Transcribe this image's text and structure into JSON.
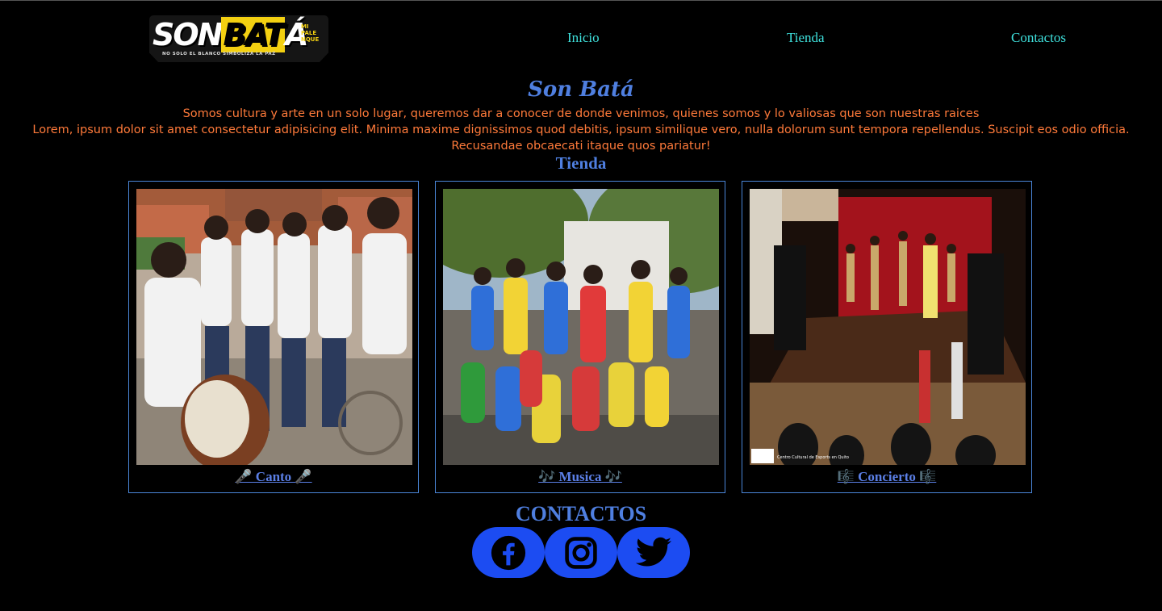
{
  "brand": {
    "logo_word": [
      "SON",
      "BAT",
      "Á"
    ],
    "logo_side_text": "MI PALE NQUE",
    "logo_tagline": "NO SOLO EL BLANCO SIMBOLIZA LA PAZ"
  },
  "nav": {
    "items": [
      "Inicio",
      "Tienda",
      "Contactos"
    ],
    "color": "#3ee0dc"
  },
  "hero": {
    "title": "Son Batá",
    "line1": "Somos cultura y arte en un solo lugar, queremos dar a conocer de donde venimos, quienes somos y lo valiosas que son nuestras raices",
    "line2": "Lorem, ipsum dolor sit amet consectetur adipisicing elit. Minima maxime dignissimos quod debitis, ipsum similique vero, nulla dolorum sunt tempora repellendus. Suscipit eos odio officia. Recusandae obcaecati itaque quos pariatur!"
  },
  "store": {
    "heading": "Tienda",
    "cards": [
      {
        "label": "🎤 Canto 🎤",
        "photo_icon": "group-with-drum-photo"
      },
      {
        "label": "🎶 Musica 🎶",
        "photo_icon": "drummers-in-park-photo"
      },
      {
        "label": "🎼 Concierto 🎼",
        "photo_icon": "concert-stage-photo",
        "watermark": "Centro Cultural de Esports en Quito"
      }
    ]
  },
  "contact": {
    "heading": "CONTACTOS",
    "networks": [
      "facebook",
      "instagram",
      "twitter"
    ],
    "button_color": "#1c4cf2"
  },
  "colors": {
    "background": "#000000",
    "accent_blue": "#4f7fe0",
    "text_orange": "#ff7a3a",
    "logo_yellow": "#f3d011"
  }
}
